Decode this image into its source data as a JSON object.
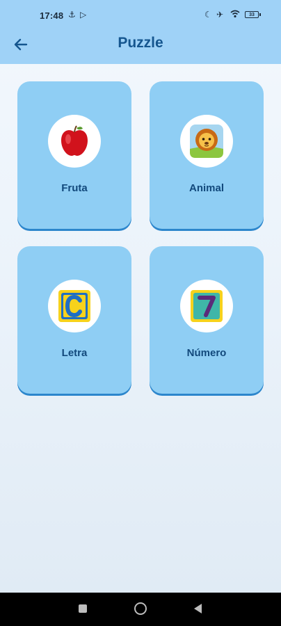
{
  "status_bar": {
    "time": "17:48",
    "icons": [
      "anchor-icon",
      "play-icon",
      "moon-icon",
      "airplane-icon",
      "wifi-icon",
      "battery-icon"
    ],
    "battery": "33"
  },
  "header": {
    "title": "Puzzle",
    "back_icon": "arrow-left-icon"
  },
  "categories": [
    {
      "label": "Fruta",
      "icon": "apple-icon"
    },
    {
      "label": "Animal",
      "icon": "lion-icon"
    },
    {
      "label": "Letra",
      "icon": "letter-c-block-icon"
    },
    {
      "label": "Número",
      "icon": "number-7-block-icon"
    }
  ],
  "colors": {
    "app_bar": "#9fd2f7",
    "card": "#8fcef4",
    "card_shadow": "#2c86cc",
    "title": "#15568f",
    "label": "#12497c"
  },
  "nav_bar": {
    "icons": [
      "recent-apps-icon",
      "home-icon",
      "back-icon"
    ]
  }
}
